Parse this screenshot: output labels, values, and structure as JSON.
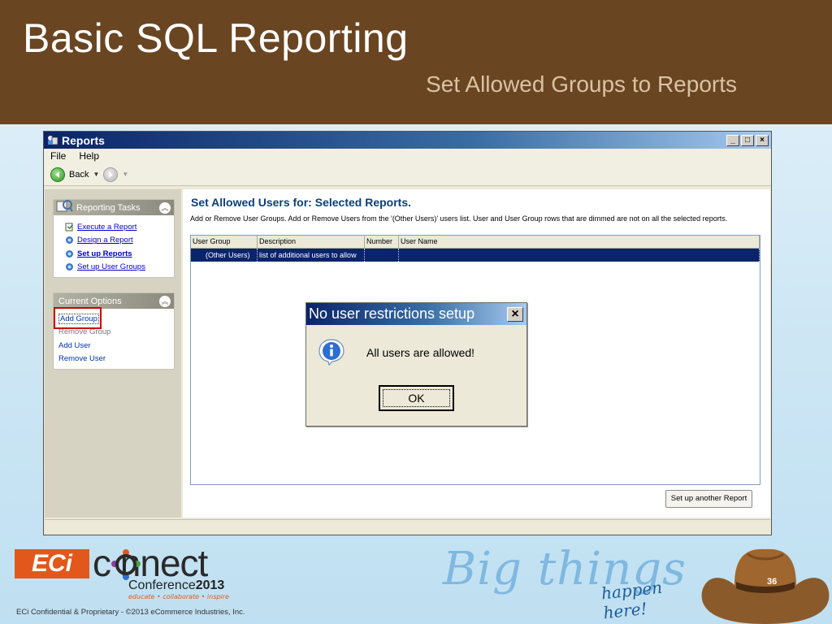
{
  "slide": {
    "title": "Basic SQL Reporting",
    "subtitle": "Set Allowed Groups to Reports",
    "number": "36",
    "footer": "ECi Confidential & Proprietary - ©2013 eCommerce Industries, Inc."
  },
  "window": {
    "title": "Reports",
    "controls": [
      "_",
      "□",
      "×"
    ],
    "menu": [
      "File",
      "Help"
    ],
    "toolbar": {
      "back_label": "Back"
    }
  },
  "left_panel": {
    "reporting_tasks": {
      "header": "Reporting Tasks",
      "items": [
        {
          "label": "Execute a Report",
          "icon": "execute-report-icon"
        },
        {
          "label": "Design a Report",
          "icon": "design-report-icon"
        },
        {
          "label": "Set up Reports",
          "icon": "setup-reports-icon"
        },
        {
          "label": "Set up User Groups",
          "icon": "setup-groups-icon"
        }
      ]
    },
    "current_options": {
      "header": "Current Options",
      "items": [
        "Add Group",
        "Remove Group",
        "Add User",
        "Remove User"
      ]
    }
  },
  "main": {
    "title": "Set Allowed Users for: Selected Reports.",
    "description": "Add or Remove User Groups.  Add or Remove Users from the '(Other Users)' users list. User and User Group rows that are dimmed are not on all the selected reports.",
    "grid": {
      "columns": [
        "User Group",
        "Description",
        "Number",
        "User Name"
      ],
      "rows": [
        {
          "user_group": "(Other Users)",
          "description": "list of additional users to allow",
          "number": "",
          "user_name": ""
        }
      ]
    },
    "setup_another_label": "Set up another Report"
  },
  "dialog": {
    "title": "No user restrictions setup",
    "message": "All users are allowed!",
    "ok_label": "OK",
    "close_label": "×"
  },
  "branding": {
    "eci": "ECi",
    "connect": "c nnect",
    "conference": "Conference",
    "year": "2013",
    "tagline": "educate • collaborate • inspire",
    "big_things": "Big things",
    "happen_here": "happen here!"
  },
  "colors": {
    "header_brown": "#6a4522",
    "title_blue": "#0a246a",
    "highlight_red": "#d00000",
    "eci_orange": "#e2581c"
  }
}
